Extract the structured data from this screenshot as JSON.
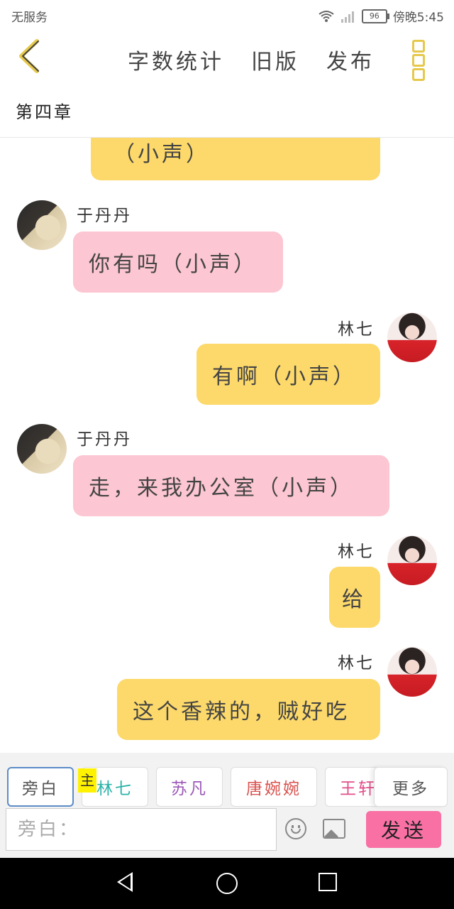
{
  "status_bar": {
    "carrier": "无服务",
    "battery": "96",
    "time": "傍晚5:45"
  },
  "header": {
    "actions": [
      "字数统计",
      "旧版",
      "发布"
    ],
    "chapter": "第四章"
  },
  "messages": [
    {
      "side": "right",
      "speaker": "",
      "text": "（小声）",
      "color": "yellow"
    },
    {
      "side": "left",
      "speaker": "于丹丹",
      "text": "你有吗（小声）",
      "color": "pink"
    },
    {
      "side": "right",
      "speaker": "林七",
      "text": "有啊（小声）",
      "color": "yellow"
    },
    {
      "side": "left",
      "speaker": "于丹丹",
      "text": "走，来我办公室（小声）",
      "color": "pink"
    },
    {
      "side": "right",
      "speaker": "林七",
      "text": "给",
      "color": "yellow"
    },
    {
      "side": "right",
      "speaker": "林七",
      "text": "这个香辣的，贼好吃",
      "color": "yellow"
    }
  ],
  "toolbar": {
    "roles": [
      {
        "label": "旁白",
        "color": "#555555",
        "active": true
      },
      {
        "label": "林七",
        "color": "#2bb3a8",
        "active": false
      },
      {
        "label": "苏凡",
        "color": "#9b59b6",
        "active": false
      },
      {
        "label": "唐婉婉",
        "color": "#d9534f",
        "active": false
      },
      {
        "label": "王轩",
        "color": "#e04f8a",
        "active": false
      }
    ],
    "main_tag": "主",
    "more_label": "更多",
    "input_placeholder": "旁白：",
    "send_label": "发送"
  },
  "icons": {
    "back": "chevron-left-icon",
    "more": "more-vertical-icon",
    "emoji": "emoji-icon",
    "image": "image-icon",
    "wifi": "wifi-icon",
    "signal": "signal-icon"
  },
  "colors": {
    "accent_yellow": "#fcd96a",
    "bubble_pink": "#fcc6d2",
    "send_pink": "#f870a4",
    "icon_gold": "#e6c84b"
  }
}
